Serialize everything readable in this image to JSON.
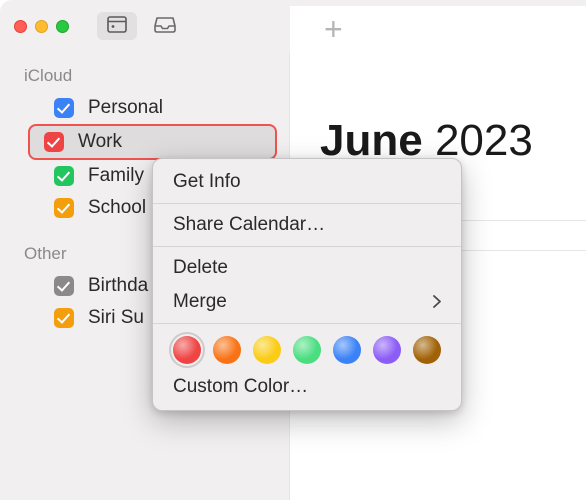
{
  "header": {
    "month": "June",
    "year": "2023"
  },
  "sidebar": {
    "sections": [
      {
        "title": "iCloud",
        "items": [
          {
            "label": "Personal",
            "color": "#3b82f6",
            "selected": false
          },
          {
            "label": "Work",
            "color": "#ef4444",
            "selected": true
          },
          {
            "label": "Family",
            "color": "#22c55e",
            "selected": false
          },
          {
            "label": "School",
            "color": "#f59e0b",
            "selected": false
          }
        ]
      },
      {
        "title": "Other",
        "items": [
          {
            "label": "Birthdays",
            "color": "#8a8a8a",
            "truncated_label": "Birthda"
          },
          {
            "label": "Siri Suggestions",
            "color": "#f59e0b",
            "truncated_label": "Siri Su"
          }
        ]
      }
    ]
  },
  "context_menu": {
    "get_info": "Get Info",
    "share": "Share Calendar…",
    "delete": "Delete",
    "merge": "Merge",
    "custom_color": "Custom Color…",
    "colors": [
      {
        "name": "red",
        "hex": "#ef4444",
        "selected": true
      },
      {
        "name": "orange",
        "hex": "#f97316",
        "selected": false
      },
      {
        "name": "yellow",
        "hex": "#facc15",
        "selected": false
      },
      {
        "name": "green",
        "hex": "#4ade80",
        "selected": false
      },
      {
        "name": "blue",
        "hex": "#3b82f6",
        "selected": false
      },
      {
        "name": "purple",
        "hex": "#8b5cf6",
        "selected": false
      },
      {
        "name": "brown",
        "hex": "#a16207",
        "selected": false
      }
    ]
  }
}
